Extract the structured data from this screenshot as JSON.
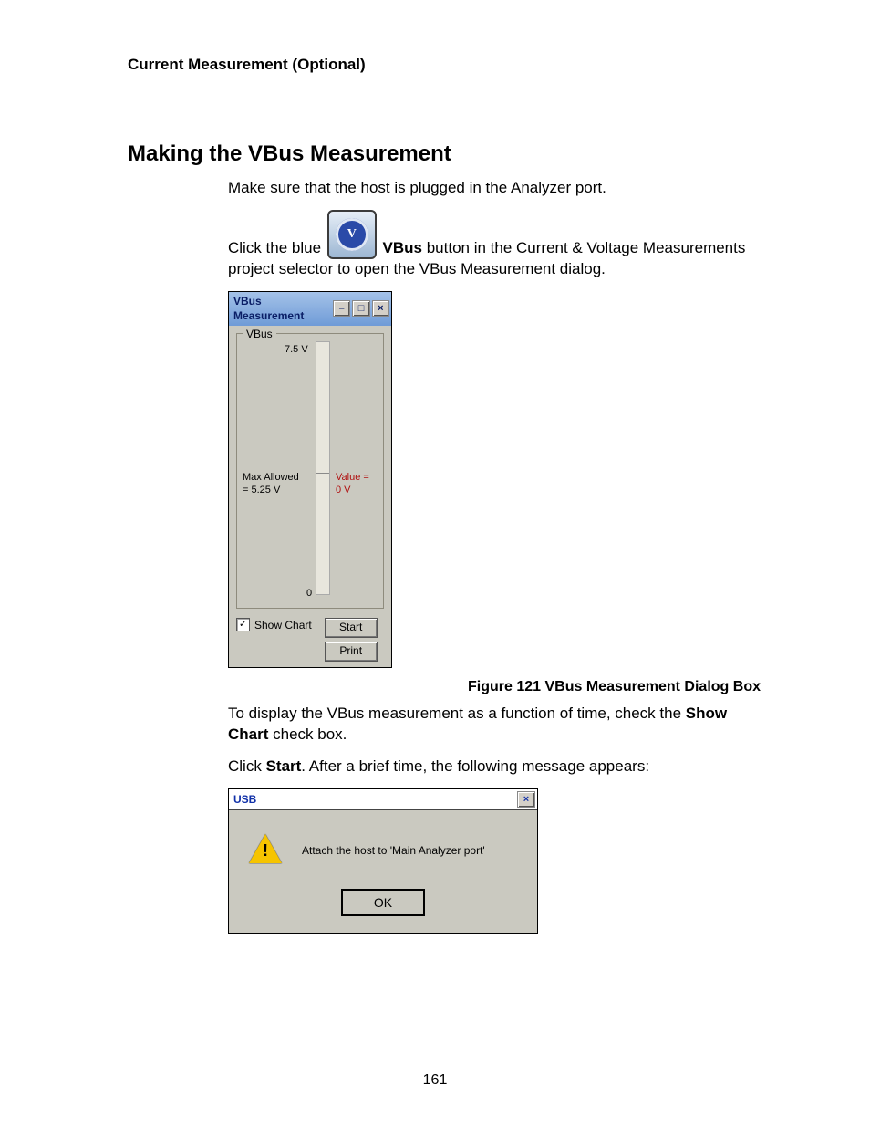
{
  "header": "Current Measurement (Optional)",
  "h2": "Making the VBus Measurement",
  "para1": "Make sure that the host is plugged in the Analyzer port.",
  "para2a": "Click the blue ",
  "para2b_bold": "VBus",
  "para2c": " button in the Current & Voltage Measurements project selector to open the VBus Measurement dialog.",
  "vbus_icon_glyph": "V",
  "vbus_dialog": {
    "title": "VBus Measurement",
    "group": "VBus",
    "axis_top": "7.5 V",
    "axis_bot": "0",
    "axis_mid": "Max Allowed\n= 5.25 V",
    "value_label": "Value =\n0 V",
    "show_chart": "Show Chart",
    "start": "Start",
    "print": "Print"
  },
  "chart_data": {
    "type": "bar",
    "categories": [
      "VBus"
    ],
    "values": [
      0
    ],
    "title": "VBus Measurement",
    "ylabel": "V",
    "ylim": [
      0,
      7.5
    ],
    "annotations": [
      "Max Allowed = 5.25 V",
      "Value = 0 V"
    ]
  },
  "fig_caption": "Figure  121  VBus Measurement Dialog Box",
  "para3a": "To display the VBus measurement as a function of time, check the ",
  "para3b_bold": "Show Chart",
  "para3c": " check box.",
  "para4a": "Click ",
  "para4b_bold": "Start",
  "para4c": ". After a brief time, the following message appears:",
  "usb_dialog": {
    "title": "USB",
    "message": "Attach the host to 'Main Analyzer port'",
    "ok": "OK"
  },
  "page_number": "161"
}
